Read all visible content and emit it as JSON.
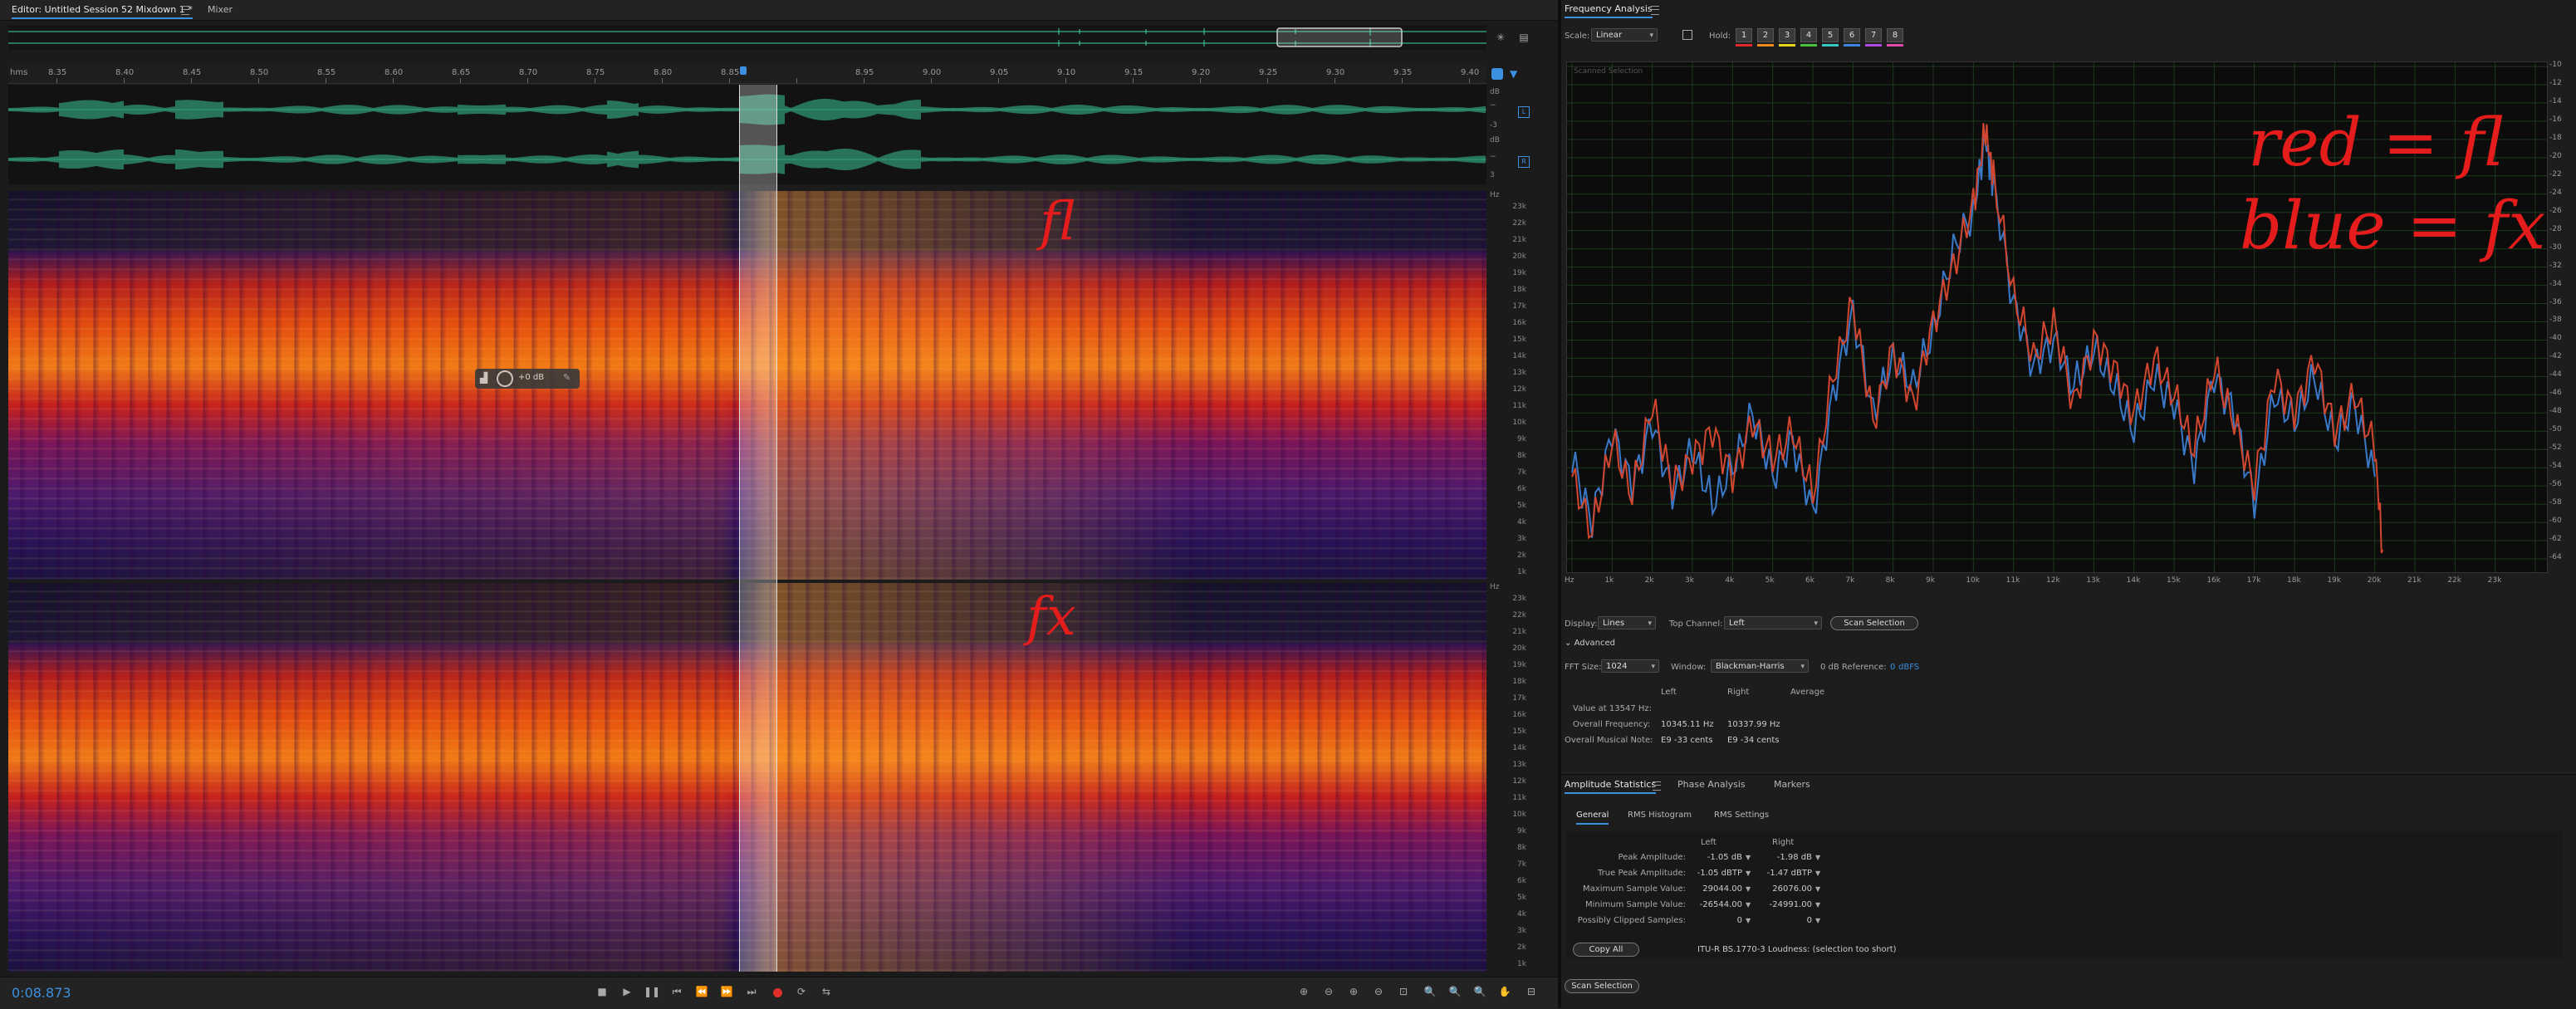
{
  "editor": {
    "tabs": [
      "Editor: Untitled Session 52 Mixdown 1 *",
      "Mixer"
    ],
    "time_ruler_unit": "hms",
    "time_ticks": [
      "8.35",
      "8.40",
      "8.45",
      "8.50",
      "8.55",
      "8.60",
      "8.65",
      "8.70",
      "8.75",
      "8.80",
      "8.85",
      "",
      "8.95",
      "9.00",
      "9.05",
      "9.10",
      "9.15",
      "9.20",
      "9.25",
      "9.30",
      "9.35",
      "9.40"
    ],
    "db_unit": "dB",
    "db_scale": [
      "−",
      "-3",
      "−",
      "3"
    ],
    "channel_badges": [
      "L",
      "R"
    ],
    "hz_unit": "Hz",
    "freq_scale": [
      "23k",
      "22k",
      "21k",
      "20k",
      "19k",
      "18k",
      "17k",
      "16k",
      "15k",
      "14k",
      "13k",
      "12k",
      "11k",
      "10k",
      "9k",
      "8k",
      "7k",
      "6k",
      "5k",
      "4k",
      "3k",
      "2k",
      "1k"
    ],
    "hud_gain": "+0 dB",
    "annotation_top": "fl",
    "annotation_bottom": "fx",
    "current_time": "0:08.873",
    "colors": {
      "waveform": "#3ed6a0",
      "accent": "#3d8fe0",
      "record": "#e0302a",
      "time": "#3d8fe0"
    }
  },
  "freq": {
    "title": "Frequency Analysis",
    "scale_label": "Scale:",
    "scale_value": "Linear",
    "hold_label": "Hold:",
    "hold_buttons": [
      "1",
      "2",
      "3",
      "4",
      "5",
      "6",
      "7",
      "8"
    ],
    "hold_colors": [
      "#e02a2a",
      "#f08a1c",
      "#e7d21e",
      "#49c43a",
      "#38c7c0",
      "#3a86e0",
      "#b04ae0",
      "#e04aa8"
    ],
    "overlay_label": "Scanned Selection",
    "y_ticks": [
      "-10",
      "-12",
      "-14",
      "-16",
      "-18",
      "-20",
      "-22",
      "-24",
      "-26",
      "-28",
      "-30",
      "-32",
      "-34",
      "-36",
      "-38",
      "-40",
      "-42",
      "-44",
      "-46",
      "-48",
      "-50",
      "-52",
      "-54",
      "-56",
      "-58",
      "-60",
      "-62",
      "-64"
    ],
    "x_ticks": [
      "Hz",
      "1k",
      "2k",
      "3k",
      "4k",
      "5k",
      "6k",
      "7k",
      "8k",
      "9k",
      "10k",
      "11k",
      "12k",
      "13k",
      "14k",
      "15k",
      "16k",
      "17k",
      "18k",
      "19k",
      "20k",
      "21k",
      "22k",
      "23k"
    ],
    "note_line1": "red = fl",
    "note_line2": "blue = fx",
    "display_label": "Display:",
    "display_value": "Lines",
    "top_channel_label": "Top Channel:",
    "top_channel_value": "Left",
    "scan_button": "Scan Selection",
    "advanced_label": "Advanced",
    "fft_label": "FFT Size:",
    "fft_value": "1024",
    "window_label": "Window:",
    "window_value": "Blackman-Harris",
    "ref_label": "0 dB Reference:",
    "ref_value": "0",
    "ref_unit": "dBFS",
    "col_headers": [
      "Left",
      "Right",
      "Average"
    ],
    "value_at": "Value at 13547 Hz:",
    "overall_freq_label": "Overall Frequency:",
    "overall_freq_left": "10345.11 Hz",
    "overall_freq_right": "10337.99 Hz",
    "note_label": "Overall Musical Note:",
    "note_left": "E9 -33 cents",
    "note_right": "E9 -34 cents"
  },
  "amp": {
    "tabs": [
      "Amplitude Statistics",
      "Phase Analysis",
      "Markers"
    ],
    "subtabs": [
      "General",
      "RMS Histogram",
      "RMS Settings"
    ],
    "col_headers": [
      "Left",
      "Right"
    ],
    "rows": [
      {
        "label": "Peak Amplitude:",
        "left": "-1.05 dB",
        "right": "-1.98 dB"
      },
      {
        "label": "True Peak Amplitude:",
        "left": "-1.05 dBTP",
        "right": "-1.47 dBTP"
      },
      {
        "label": "Maximum Sample Value:",
        "left": "29044.00",
        "right": "26076.00"
      },
      {
        "label": "Minimum Sample Value:",
        "left": "-26544.00",
        "right": "-24991.00"
      },
      {
        "label": "Possibly Clipped Samples:",
        "left": "0",
        "right": "0"
      }
    ],
    "copy_button": "Copy All",
    "loudness_text": "ITU-R BS.1770-3 Loudness: (selection too short)",
    "scan_button": "Scan Selection"
  },
  "chart_data": {
    "type": "line",
    "title": "",
    "xlabel": "",
    "ylabel": "",
    "xlim": [
      0,
      24000
    ],
    "ylim": [
      -65,
      -10
    ],
    "series": [
      {
        "name": "fl",
        "color": "#d0462e",
        "x": [
          0,
          500,
          1000,
          1500,
          2000,
          2500,
          3000,
          3500,
          4000,
          4500,
          5000,
          5500,
          6000,
          6500,
          7000,
          7500,
          8000,
          8500,
          9000,
          9500,
          10000,
          10300,
          10500,
          11000,
          11500,
          12000,
          12500,
          13000,
          13500,
          14000,
          14500,
          15000,
          15500,
          16000,
          16500,
          17000,
          17500,
          18000,
          18500,
          19000,
          19500,
          20000,
          20200
        ],
        "y": [
          -55,
          -61,
          -51,
          -57,
          -47,
          -56,
          -53,
          -50,
          -55,
          -49,
          -53,
          -50,
          -57,
          -44,
          -36,
          -49,
          -41,
          -47,
          -38,
          -32,
          -25,
          -17,
          -22,
          -35,
          -42,
          -38,
          -47,
          -40,
          -43,
          -48,
          -42,
          -46,
          -52,
          -43,
          -49,
          -56,
          -44,
          -48,
          -42,
          -50,
          -46,
          -52,
          -63
        ]
      },
      {
        "name": "fx",
        "color": "#3a78c8",
        "x": [
          0,
          500,
          1000,
          1500,
          2000,
          2500,
          3000,
          3500,
          4000,
          4500,
          5000,
          5500,
          6000,
          6500,
          7000,
          7500,
          8000,
          8500,
          9000,
          9500,
          10000,
          10300,
          10500,
          11000,
          11500,
          12000,
          12500,
          13000,
          13500,
          14000,
          14500,
          15000,
          15500,
          16000,
          16500,
          17000,
          17500,
          18000,
          18500,
          19000,
          19500,
          20000
        ],
        "y": [
          -53,
          -60,
          -50,
          -56,
          -49,
          -57,
          -52,
          -58,
          -54,
          -48,
          -55,
          -51,
          -59,
          -46,
          -37,
          -48,
          -42,
          -45,
          -39,
          -30,
          -26,
          -18,
          -23,
          -36,
          -43,
          -40,
          -45,
          -41,
          -45,
          -50,
          -44,
          -47,
          -54,
          -44,
          -48,
          -58,
          -46,
          -49,
          -44,
          -51,
          -47,
          -55
        ]
      }
    ]
  }
}
